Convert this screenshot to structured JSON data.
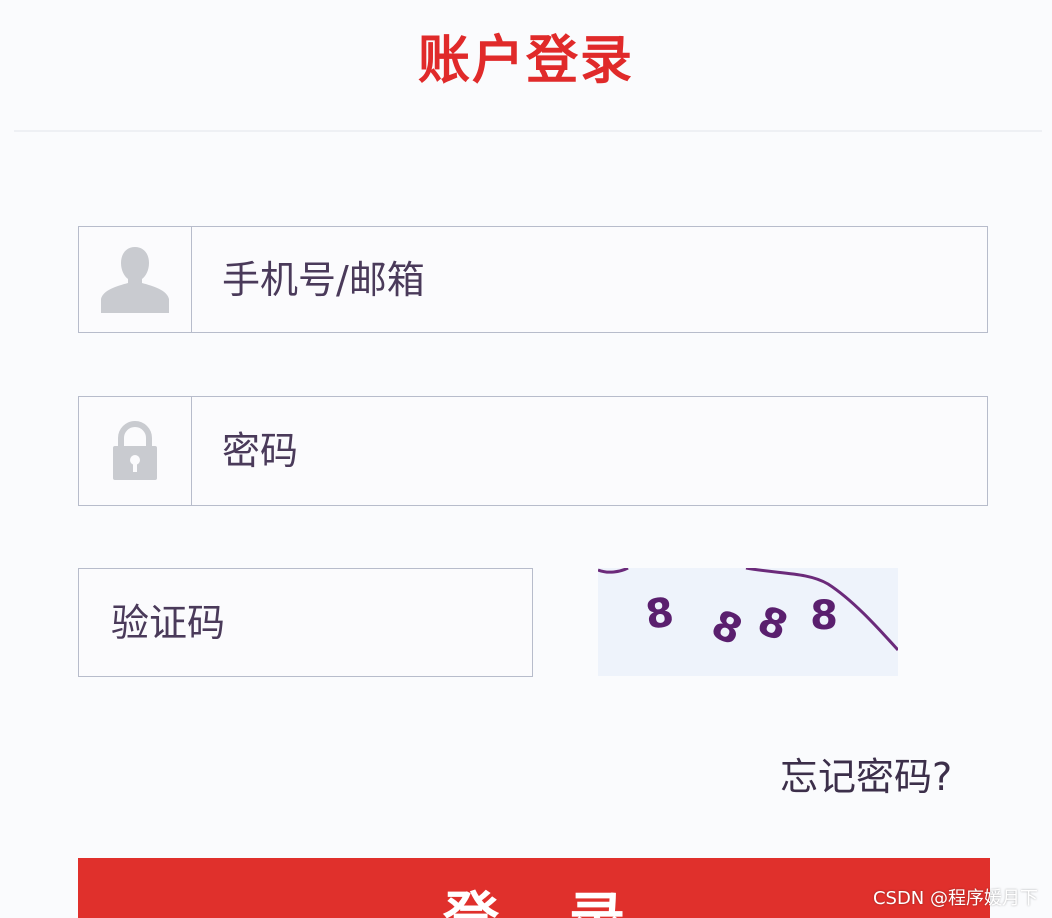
{
  "header": {
    "title": "账户登录"
  },
  "form": {
    "username": {
      "placeholder": "手机号/邮箱",
      "value": "",
      "icon": "user-icon"
    },
    "password": {
      "placeholder": "密码",
      "value": "",
      "icon": "lock-icon"
    },
    "captcha": {
      "placeholder": "验证码",
      "value": "",
      "code": "8888"
    },
    "forgot_password_label": "忘记密码?",
    "login_button_label": "登录"
  },
  "watermark": "CSDN @程序媛月下",
  "colors": {
    "accent": "#e0302c",
    "title": "#e02a2a",
    "captcha_text": "#5a1f6e",
    "icon_gray": "#c9cbd0"
  }
}
